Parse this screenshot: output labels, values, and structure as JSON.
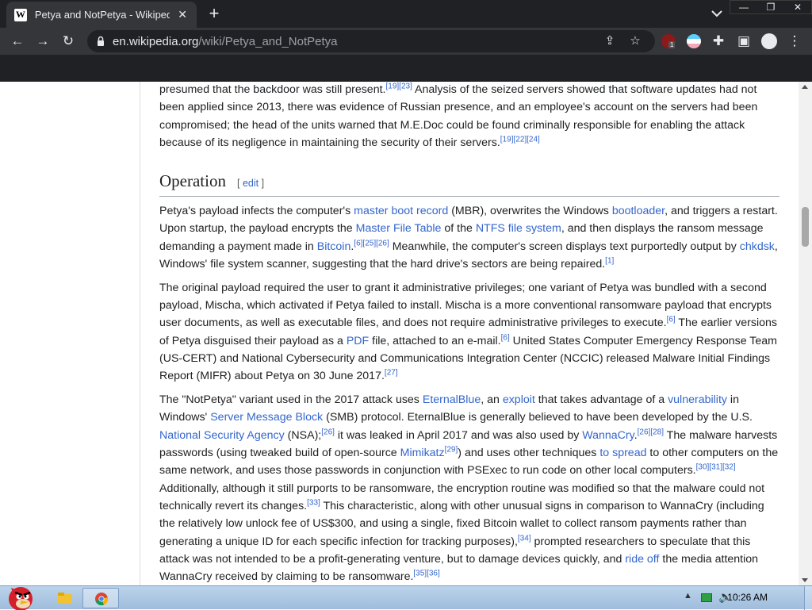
{
  "tab": {
    "title": "Petya and NotPetya - Wikipedia",
    "favicon": "W"
  },
  "window_controls": {
    "minimize": "—",
    "restore": "❐",
    "close": "✕"
  },
  "toolbar": {
    "url_host": "en.wikipedia.org",
    "url_path": "/wiki/Petya_and_NotPetya",
    "extension_badge": "1"
  },
  "article": {
    "p0": {
      "t1": "presumed that the backdoor was still present.",
      "r1": "[19][23]",
      "t2": " Analysis of the seized servers showed that software updates had not been applied since 2013, there was evidence of Russian presence, and an employee's account on the servers had been compromised; the head of the units warned that M.E.Doc could be found criminally responsible for enabling the attack because of its negligence in maintaining the security of their servers.",
      "r2": "[19][22][24]"
    },
    "heading": "Operation",
    "edit_open": "[ ",
    "edit_label": "edit",
    "edit_close": " ]",
    "p1": {
      "t1": "Petya's payload infects the computer's ",
      "l1": "master boot record",
      "t2": " (MBR), overwrites the Windows ",
      "l2": "bootloader",
      "t3": ", and triggers a restart. Upon startup, the payload encrypts the ",
      "l3": "Master File Table",
      "t4": " of the ",
      "l4": "NTFS file system",
      "t5": ", and then displays the ransom message demanding a payment made in ",
      "l5": "Bitcoin",
      "t6": ".",
      "r1": "[6][25][26]",
      "t7": " Meanwhile, the computer's screen displays text purportedly output by ",
      "l6": "chkdsk",
      "t8": ", Windows' file system scanner, suggesting that the hard drive's sectors are being repaired.",
      "r2": "[1]"
    },
    "p2": {
      "t1": "The original payload required the user to grant it administrative privileges; one variant of Petya was bundled with a second payload, Mischa, which activated if Petya failed to install. Mischa is a more conventional ransomware payload that encrypts user documents, as well as executable files, and does not require administrative privileges to execute.",
      "r1": "[6]",
      "t2": " The earlier versions of Petya disguised their payload as a ",
      "l1": "PDF",
      "t3": " file, attached to an e-mail.",
      "r2": "[6]",
      "t4": " United States Computer Emergency Response Team (US-CERT) and National Cybersecurity and Communications Integration Center (NCCIC) released Malware Initial Findings Report (MIFR) about Petya on 30 June 2017.",
      "r3": "[27]"
    },
    "p3": {
      "t1": "The \"NotPetya\" variant used in the 2017 attack uses ",
      "l1": "EternalBlue",
      "t2": ", an ",
      "l2": "exploit",
      "t3": " that takes advantage of a ",
      "l3": "vulnerability",
      "t4": " in Windows' ",
      "l4": "Server Message Block",
      "t5": " (SMB) protocol. EternalBlue is generally believed to have been developed by the U.S. ",
      "l5": "National Security Agency",
      "t6": " (NSA);",
      "r1": "[26]",
      "t7": " it was leaked in April 2017 and was also used by ",
      "l6": "WannaCry",
      "t8": ".",
      "r2": "[26][28]",
      "t9": " The malware harvests passwords (using tweaked build of open-source ",
      "l7": "Mimikatz",
      "r3": "[29]",
      "t10": ") and uses other techniques ",
      "l8": "to spread",
      "t11": " to other computers on the same network, and uses those passwords in conjunction with PSExec to run code on other local computers.",
      "r4": "[30][31][32]",
      "t12": " Additionally, although it still purports to be ransomware, the encryption routine was modified so that the malware could not technically revert its changes.",
      "r5": "[33]",
      "t13": " This characteristic, along with other unusual signs in comparison to WannaCry (including the relatively low unlock fee of US$300, and using a single, fixed Bitcoin wallet to collect ransom payments rather than generating a unique ID for each specific infection for tracking purposes),",
      "r6": "[34]",
      "t14": " prompted researchers to speculate that this attack was not intended to be a profit-generating venture, but to damage devices quickly, and ",
      "l9": "ride off",
      "t15": " the media attention WannaCry received by claiming to be ransomware.",
      "r7": "[35][36]"
    }
  },
  "taskbar": {
    "time": "10:26 AM"
  }
}
